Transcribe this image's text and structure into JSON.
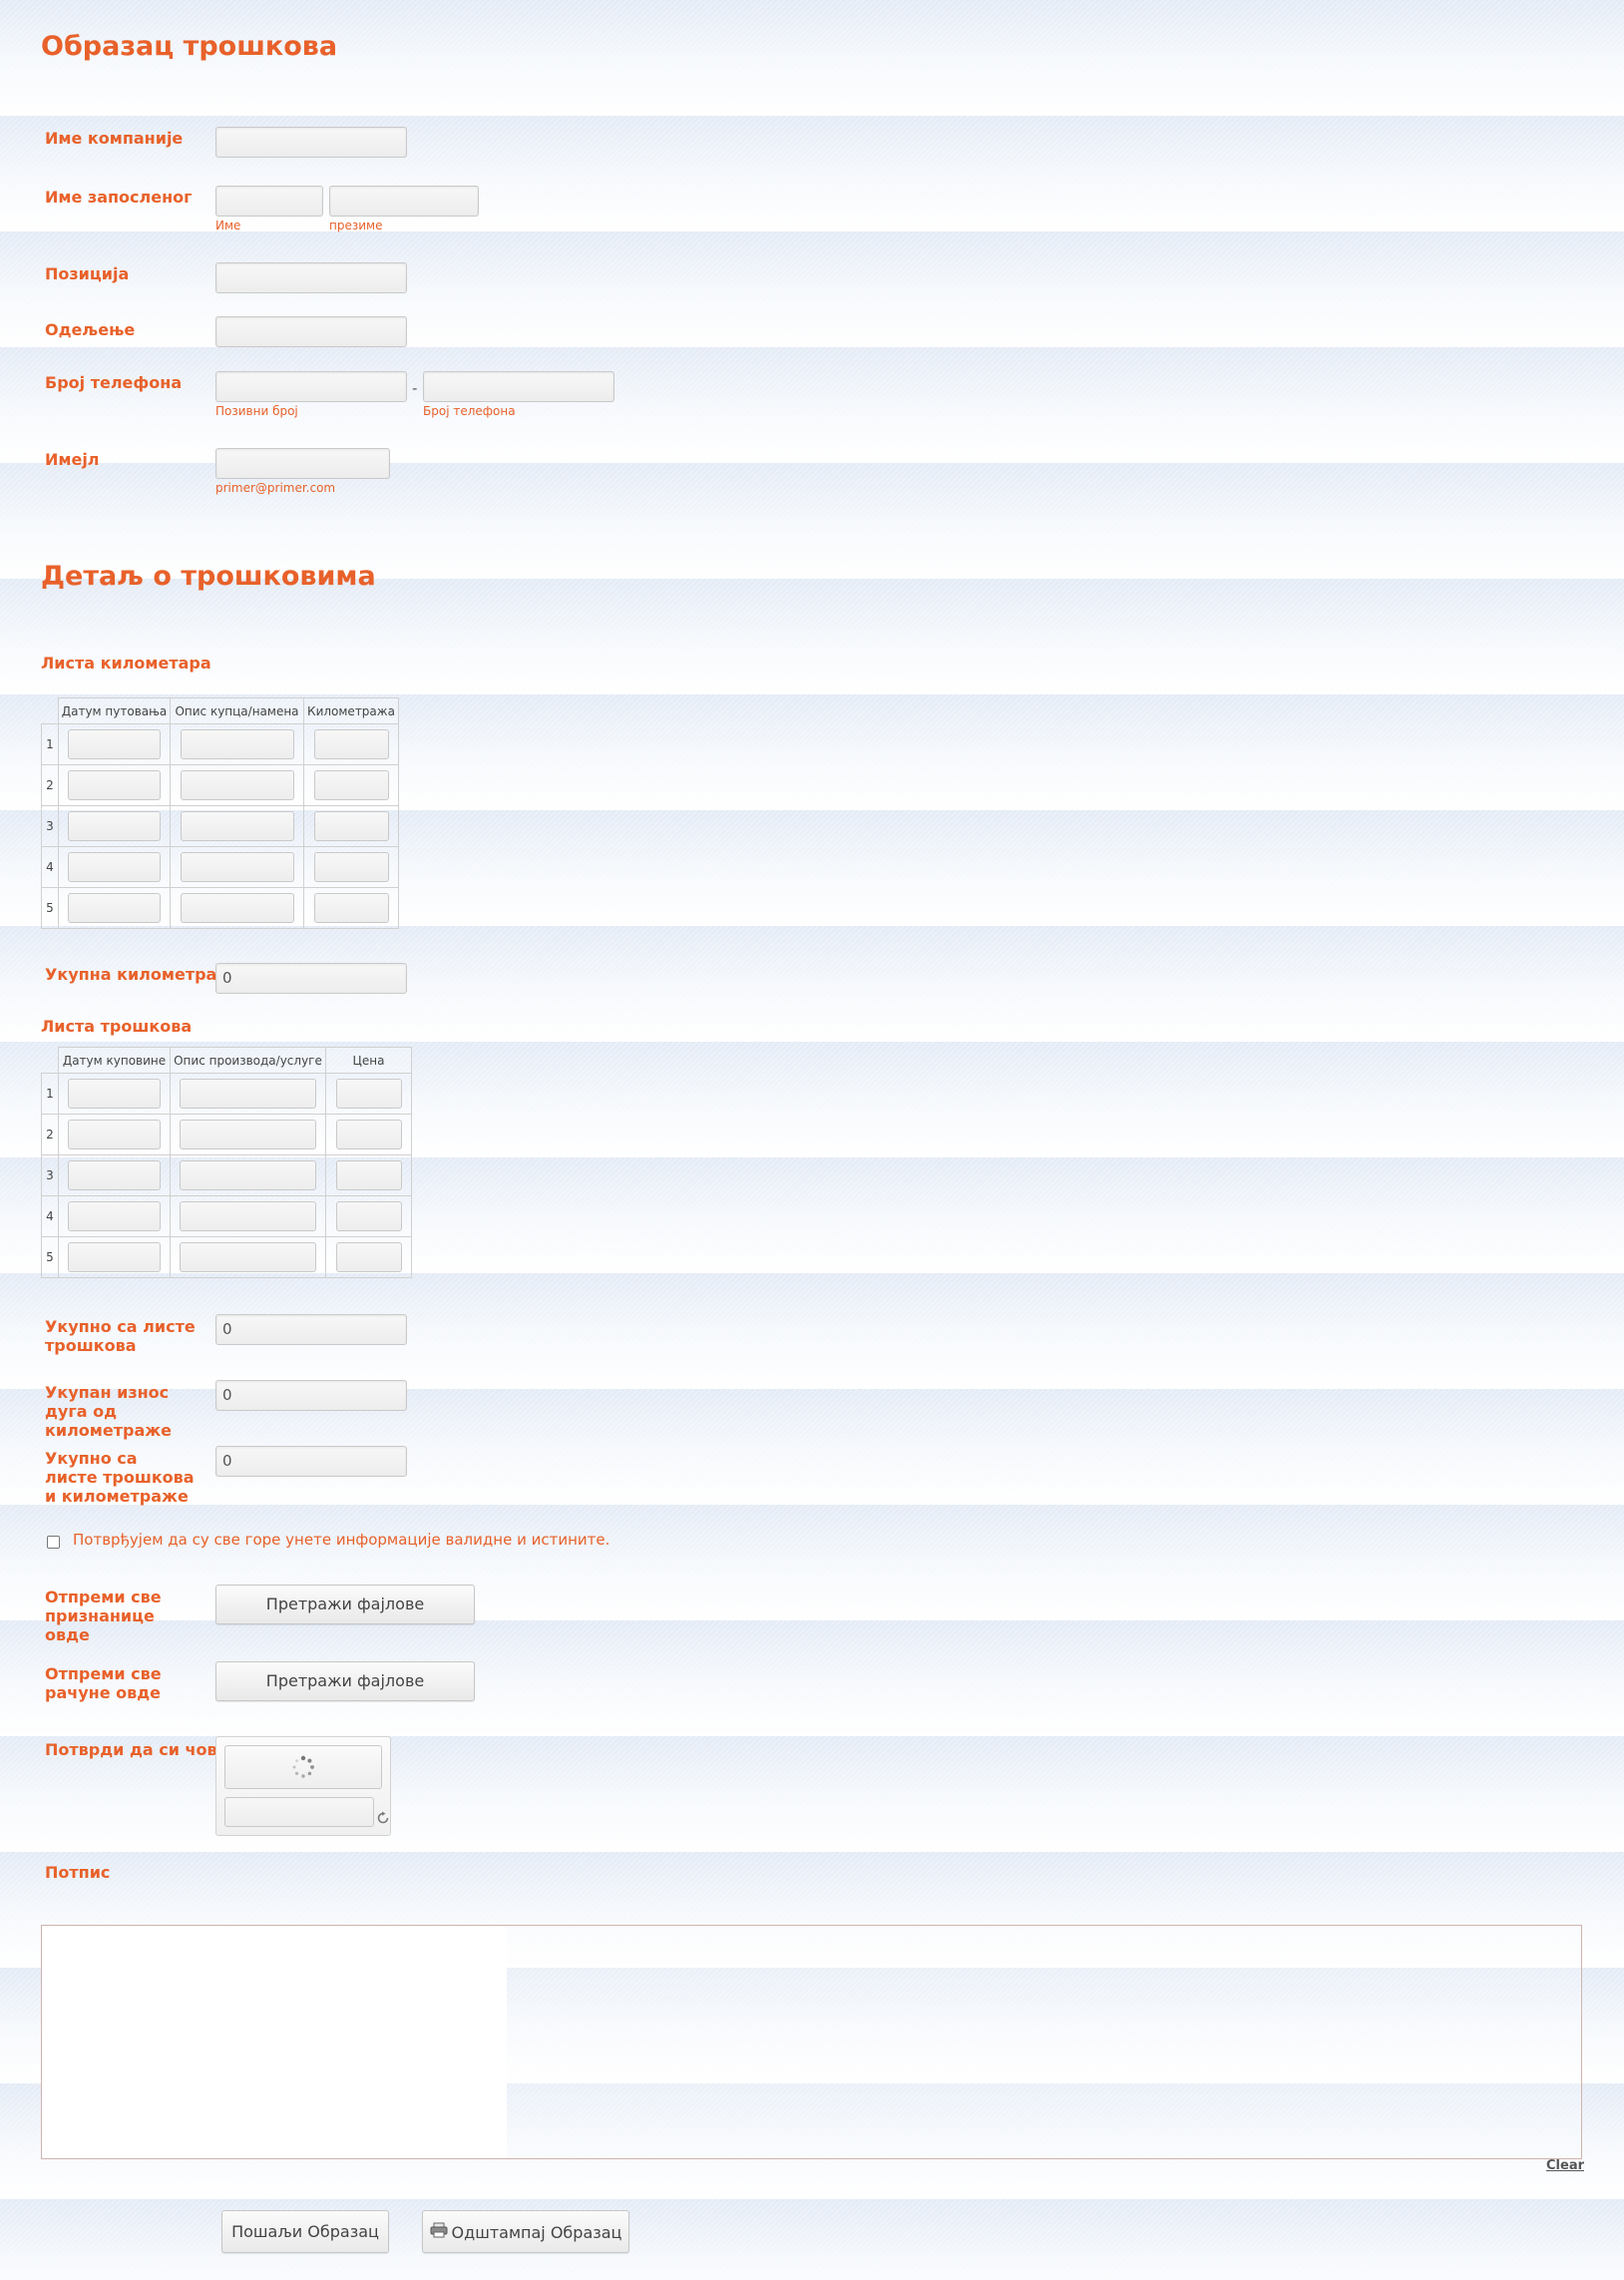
{
  "form": {
    "title": "Образац трошкова",
    "company_label": "Име компаније",
    "employee_label": "Име запосленог",
    "first_name_sublabel": "Име",
    "last_name_sublabel": "презиме",
    "position_label": "Позиција",
    "department_label": "Одељење",
    "phone_label": "Број телефона",
    "phone_separator": "-",
    "area_code_sublabel": "Позивни број",
    "phone_number_sublabel": "Број телефона",
    "email_label": "Имејл",
    "email_sublabel": "primer@primer.com"
  },
  "details": {
    "heading": "Детаљ о трошковима",
    "mileage_title": "Листа километара",
    "mileage_columns": [
      "Датум путовања",
      "Опис купца/намена",
      "Километража"
    ],
    "mileage_rows": [
      "1",
      "2",
      "3",
      "4",
      "5"
    ],
    "total_mileage_label": "Укупна километража",
    "total_mileage_value": "0",
    "expense_title": "Листа трошкова",
    "expense_columns": [
      "Датум куповине",
      "Опис производа/услуге",
      "Цена"
    ],
    "expense_rows": [
      "1",
      "2",
      "3",
      "4",
      "5"
    ],
    "total_expense_label": "Укупно са листе трошкова",
    "total_expense_value": "0",
    "mileage_debt_label": "Укупан износ дуга од километраже",
    "mileage_debt_value": "0",
    "grand_total_label": "Укупно са листе трошкова и километраже",
    "grand_total_value": "0",
    "confirm_text": "Потврђујем да су све горе унете информације валидне и истините.",
    "receipts_label": "Отпреми све признанице овде",
    "invoices_label": "Отпреми све рачуне овде",
    "browse_label": "Претражи фајлове",
    "captcha_label": "Потврди да си човек",
    "signature_label": "Потпис",
    "clear_label": "Clear",
    "submit_label": "Пошаљи Образац",
    "print_label": "Одштампај Образац"
  },
  "icons": [
    "spinner-icon",
    "refresh-icon",
    "printer-icon"
  ],
  "colors": {
    "accent": "#e8612a"
  }
}
